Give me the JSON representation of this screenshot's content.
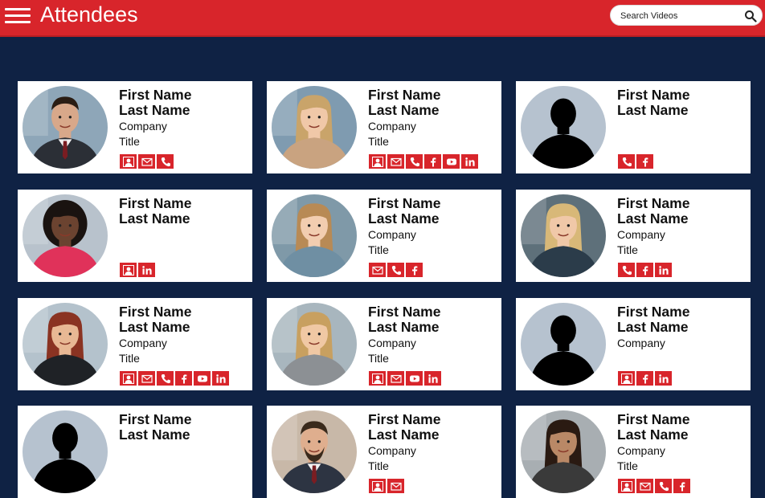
{
  "header": {
    "title": "Attendees",
    "search_placeholder": "Search Videos"
  },
  "attendees": [
    {
      "first": "First Name",
      "last": "Last Name",
      "company": "Company",
      "title": "Title",
      "photo": {
        "type": "man",
        "skin": "#d8a88a",
        "hair": "#2a1d14",
        "top": "#2b2f36",
        "bg": "#8ea6b8"
      },
      "icons": [
        "profile-icon",
        "email-icon",
        "phone-icon"
      ]
    },
    {
      "first": "First Name",
      "last": "Last Name",
      "company": "Company",
      "title": "Title",
      "photo": {
        "type": "woman",
        "skin": "#f0c8a8",
        "hair": "#c9a46a",
        "top": "#c9a380",
        "bg": "#7f9bb0"
      },
      "icons": [
        "profile-icon",
        "email-icon",
        "phone-icon",
        "facebook-icon",
        "youtube-icon",
        "linkedin-icon"
      ]
    },
    {
      "first": "First Name",
      "last": "Last Name",
      "company": "",
      "title": "",
      "photo": {
        "type": "silhouette"
      },
      "icons": [
        "phone-icon",
        "facebook-icon"
      ]
    },
    {
      "first": "First Name",
      "last": "Last Name",
      "company": "",
      "title": "",
      "photo": {
        "type": "curly",
        "skin": "#6b4330",
        "hair": "#1a1310",
        "top": "#e0325a",
        "bg": "#b8c2cc"
      },
      "icons": [
        "profile-icon",
        "linkedin-icon"
      ]
    },
    {
      "first": "First Name",
      "last": "Last Name",
      "company": "Company",
      "title": "Title",
      "photo": {
        "type": "woman",
        "skin": "#f2cdb0",
        "hair": "#b88a55",
        "top": "#6f8fa3",
        "bg": "#7f99a8"
      },
      "icons": [
        "email-icon",
        "phone-icon",
        "facebook-icon"
      ]
    },
    {
      "first": "First Name",
      "last": "Last Name",
      "company": "Company",
      "title": "Title",
      "photo": {
        "type": "woman",
        "skin": "#f0c8a8",
        "hair": "#d8b878",
        "top": "#2b3c4a",
        "bg": "#5e707a"
      },
      "icons": [
        "phone-icon",
        "facebook-icon",
        "linkedin-icon"
      ]
    },
    {
      "first": "First Name",
      "last": "Last Name",
      "company": "Company",
      "title": "Title",
      "photo": {
        "type": "woman",
        "skin": "#e8b894",
        "hair": "#8a3322",
        "top": "#1f2226",
        "bg": "#b4c2cc"
      },
      "icons": [
        "profile-icon",
        "email-icon",
        "phone-icon",
        "facebook-icon",
        "youtube-icon",
        "linkedin-icon"
      ]
    },
    {
      "first": "First Name",
      "last": "Last Name",
      "company": "Company",
      "title": "Title",
      "photo": {
        "type": "woman",
        "skin": "#f0c8a4",
        "hair": "#c8a060",
        "top": "#8c9094",
        "bg": "#a8b6be"
      },
      "icons": [
        "profile-icon",
        "email-icon",
        "youtube-icon",
        "linkedin-icon"
      ]
    },
    {
      "first": "First Name",
      "last": "Last Name",
      "company": "Company",
      "title": "",
      "photo": {
        "type": "silhouette"
      },
      "icons": [
        "profile-icon",
        "facebook-icon",
        "linkedin-icon"
      ]
    },
    {
      "first": "First Name",
      "last": "Last Name",
      "company": "",
      "title": "",
      "photo": {
        "type": "silhouette"
      },
      "icons": []
    },
    {
      "first": "First Name",
      "last": "Last Name",
      "company": "Company",
      "title": "Title",
      "photo": {
        "type": "man",
        "skin": "#dfae8e",
        "hair": "#3a2a1c",
        "top": "#2d3442",
        "bg": "#c8b8a8",
        "beard": true
      },
      "icons": [
        "profile-icon",
        "email-icon"
      ]
    },
    {
      "first": "First Name",
      "last": "Last Name",
      "company": "Company",
      "title": "Title",
      "photo": {
        "type": "woman",
        "skin": "#b98866",
        "hair": "#2a1a12",
        "top": "#3a3a3a",
        "bg": "#a8aeb2"
      },
      "icons": [
        "profile-icon",
        "email-icon",
        "phone-icon",
        "facebook-icon"
      ]
    }
  ]
}
